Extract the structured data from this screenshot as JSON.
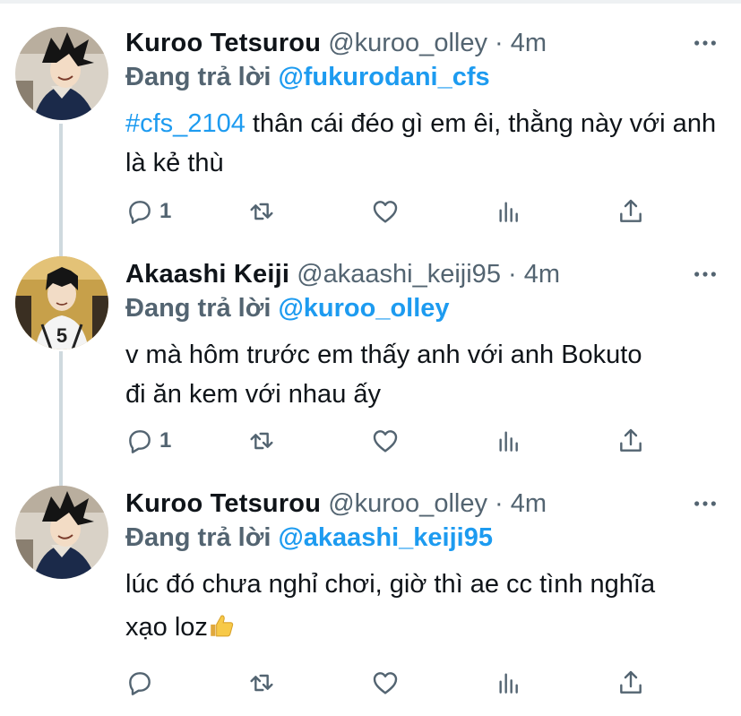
{
  "tweets": [
    {
      "name": "Kuroo Tetsurou",
      "handle": "@kuroo_olley",
      "time": "· 4m",
      "reply_prefix": "Đang trả lời",
      "reply_to": "@fukurodani_cfs",
      "hashtag": "#cfs_2104",
      "text": " thân cái đéo gì em êi, thằng này với anh là kẻ thù",
      "reply_count": "1",
      "avatar": "kuroo-avatar"
    },
    {
      "name": "Akaashi Keiji",
      "handle": "@akaashi_keiji95",
      "time": "· 4m",
      "reply_prefix": "Đang trả lời",
      "reply_to": "@kuroo_olley",
      "text": "v mà hôm trước em thấy anh với anh Bokuto đi ăn kem với nhau ấy",
      "reply_count": "1",
      "avatar": "akaashi-avatar"
    },
    {
      "name": "Kuroo Tetsurou",
      "handle": "@kuroo_olley",
      "time": "· 4m",
      "reply_prefix": "Đang trả lời",
      "reply_to": "@akaashi_keiji95",
      "text": "lúc đó chưa nghỉ chơi, giờ thì ae cc tình nghĩa xạo loz",
      "emoji": "thumbs-up-emoji",
      "reply_count": "",
      "avatar": "kuroo-avatar"
    }
  ],
  "icons": [
    "more-icon",
    "reply-icon",
    "retweet-icon",
    "like-icon",
    "analytics-icon",
    "share-icon"
  ],
  "colors": {
    "link": "#1d9bf0",
    "secondary": "#536471",
    "text": "#0f1419",
    "thread_line": "#cfd9de"
  }
}
